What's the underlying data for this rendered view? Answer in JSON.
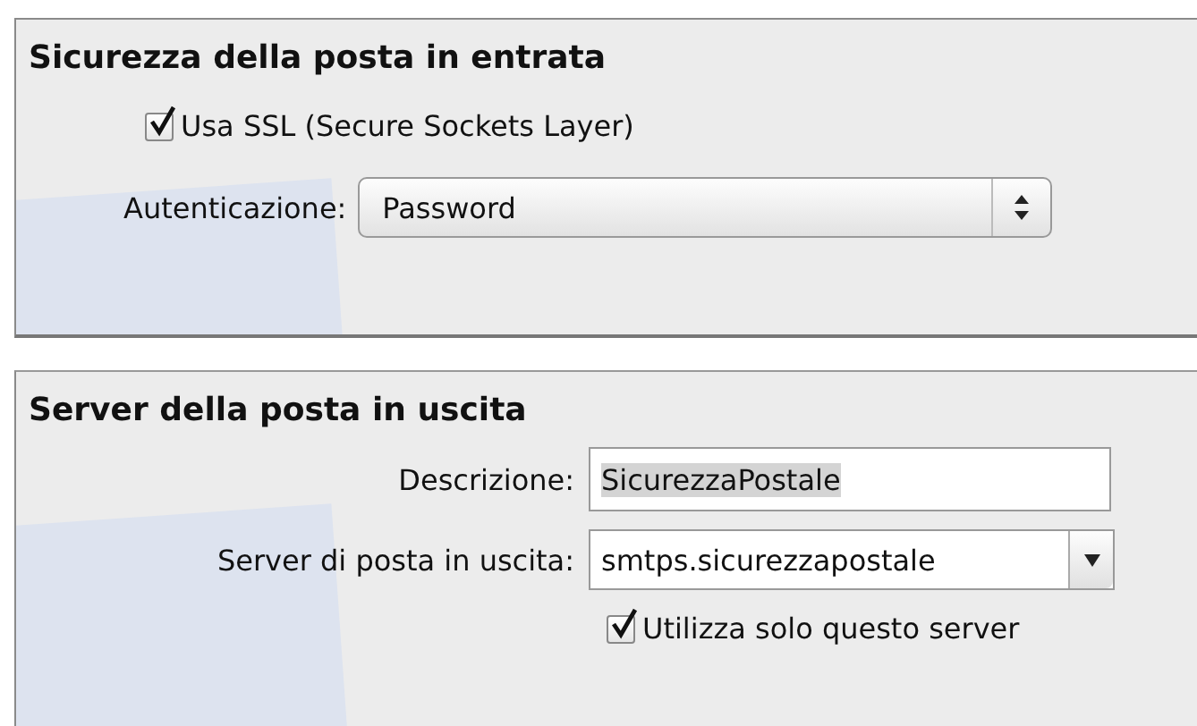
{
  "incoming_security": {
    "title": "Sicurezza della posta in entrata",
    "use_ssl": {
      "label": "Usa SSL (Secure Sockets Layer)",
      "checked": true
    },
    "authentication": {
      "label": "Autenticazione:",
      "value": "Password"
    }
  },
  "outgoing_server": {
    "title": "Server della posta in uscita",
    "description": {
      "label": "Descrizione:",
      "value": "SicurezzaPostale",
      "value_selected": true
    },
    "server": {
      "label": "Server di posta in uscita:",
      "value": "smtps.sicurezzapostale"
    },
    "use_only_this_server": {
      "label": "Utilizza solo questo server",
      "checked": true
    }
  }
}
